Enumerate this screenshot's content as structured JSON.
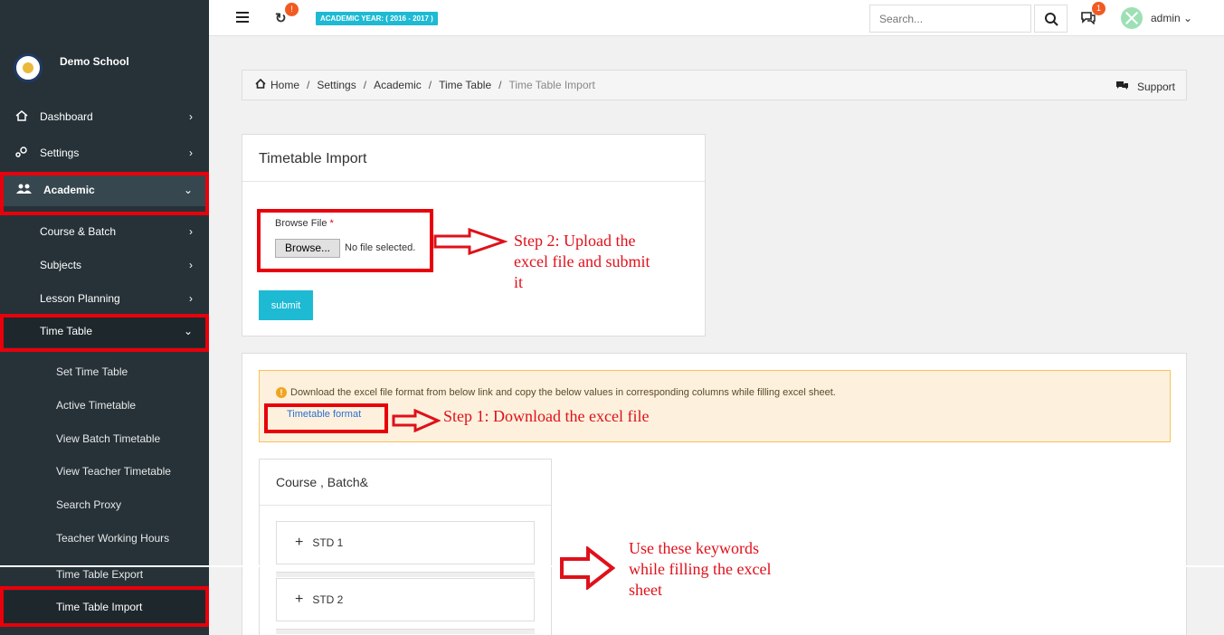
{
  "sidebar": {
    "brand": "Demo School",
    "items": [
      {
        "label": "Dashboard",
        "icon": "home-icon"
      },
      {
        "label": "Settings",
        "icon": "gear-icon"
      },
      {
        "label": "Academic",
        "icon": "users-icon"
      }
    ],
    "academic_sub": [
      "Course & Batch",
      "Subjects",
      "Lesson Planning",
      "Time Table"
    ],
    "timetable_sub": [
      "Set Time Table",
      "Active Timetable",
      "View Batch Timetable",
      "View Teacher Timetable",
      "Search Proxy",
      "Teacher Working Hours",
      "Time Table Export",
      "Time Table Import"
    ]
  },
  "topbar": {
    "sync_badge": "!",
    "academic_year": "ACADEMIC YEAR: ( 2016 - 2017 )",
    "search_placeholder": "Search...",
    "chat_badge": "1",
    "user": "admin"
  },
  "breadcrumb": {
    "items": [
      "Home",
      "Settings",
      "Academic",
      "Time Table"
    ],
    "current": "Time Table Import",
    "support": "Support"
  },
  "import": {
    "title": "Timetable Import",
    "browse_label": "Browse File",
    "required_mark": "*",
    "browse_button": "Browse...",
    "no_file": "No file selected.",
    "submit": "submit"
  },
  "info": {
    "message": "Download the excel file format from below link and copy the below values in corresponding columns while filling excel sheet.",
    "link": "Timetable format"
  },
  "course": {
    "title": "Course , Batch&",
    "items": [
      "STD 1",
      "STD 2"
    ]
  },
  "annotations": {
    "step2": [
      "Step 2: Upload the",
      "excel file and submit",
      "it"
    ],
    "step1": "Step 1: Download the excel file",
    "keywords": [
      "Use these keywords",
      "while filling the excel",
      "sheet"
    ]
  },
  "colors": {
    "sidebar": "#263238",
    "accent": "#1ebad3",
    "annotation": "#e0101a",
    "badge": "#f15a22"
  }
}
